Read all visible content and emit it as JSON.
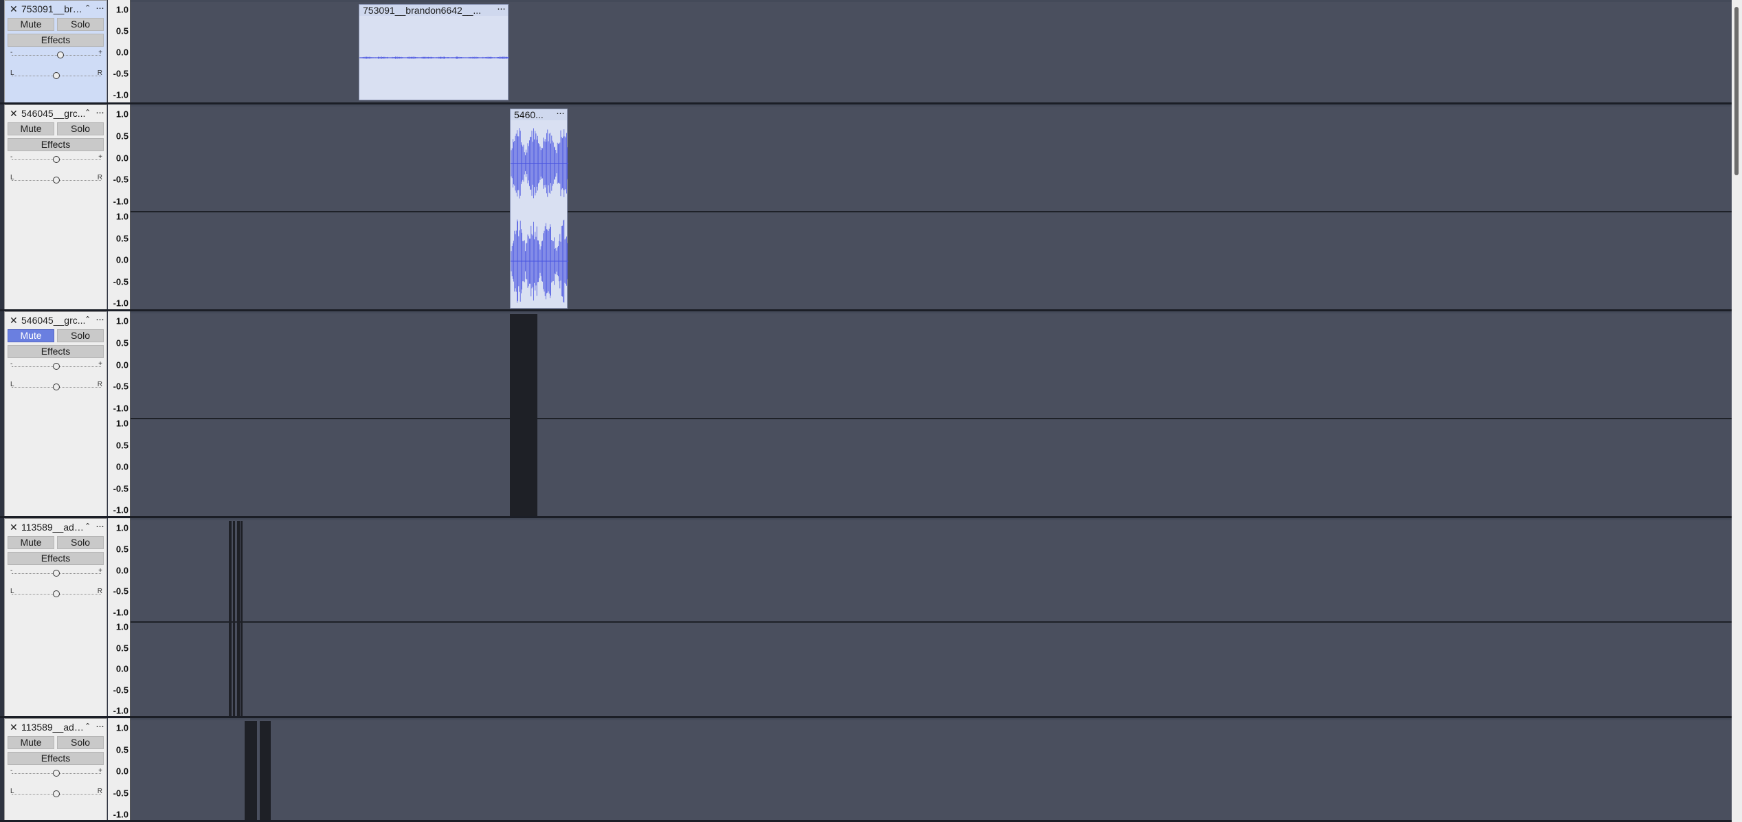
{
  "tracks": [
    {
      "id": "t1",
      "name": "753091__bra...",
      "selected": true,
      "mute": {
        "label": "Mute",
        "active": false
      },
      "solo": {
        "label": "Solo"
      },
      "effects_label": "Effects",
      "gain_minus": "-",
      "gain_plus": "+",
      "pan_left": "L",
      "pan_right": "R",
      "gain_level": 0.55,
      "pan_level": 0.5,
      "channels": 1,
      "clips": [
        {
          "title": "753091__brandon6642__...",
          "amplitude": 0.03
        }
      ]
    },
    {
      "id": "t2",
      "name": "546045__grc...",
      "selected": false,
      "mute": {
        "label": "Mute",
        "active": false
      },
      "solo": {
        "label": "Solo"
      },
      "effects_label": "Effects",
      "gain_minus": "-",
      "gain_plus": "+",
      "pan_left": "L",
      "pan_right": "R",
      "gain_level": 0.5,
      "pan_level": 0.5,
      "channels": 2,
      "clips": [
        {
          "title": "5460...",
          "amplitude": 0.95
        }
      ]
    },
    {
      "id": "t3",
      "name": "546045__grc...",
      "selected": false,
      "mute": {
        "label": "Mute",
        "active": true
      },
      "solo": {
        "label": "Solo"
      },
      "effects_label": "Effects",
      "gain_minus": "-",
      "gain_plus": "+",
      "pan_left": "L",
      "pan_right": "R",
      "gain_level": 0.5,
      "pan_level": 0.5,
      "channels": 2,
      "clips": []
    },
    {
      "id": "t4",
      "name": "113589__ada...",
      "selected": false,
      "mute": {
        "label": "Mute",
        "active": false
      },
      "solo": {
        "label": "Solo"
      },
      "effects_label": "Effects",
      "gain_minus": "-",
      "gain_plus": "+",
      "pan_left": "L",
      "pan_right": "R",
      "gain_level": 0.5,
      "pan_level": 0.5,
      "channels": 2,
      "clips": []
    },
    {
      "id": "t5",
      "name": "113589__ada...",
      "selected": false,
      "mute": {
        "label": "Mute",
        "active": false
      },
      "solo": {
        "label": "Solo"
      },
      "effects_label": "Effects",
      "gain_minus": "-",
      "gain_plus": "+",
      "pan_left": "L",
      "pan_right": "R",
      "gain_level": 0.5,
      "pan_level": 0.5,
      "channels": 1,
      "clips": []
    }
  ],
  "scale_labels": [
    "1.0",
    "0.5",
    "0.0",
    "-0.5",
    "-1.0"
  ],
  "icons": {
    "close": "close-icon",
    "collapse": "collapse-icon",
    "menu": "menu-icon"
  },
  "colors": {
    "waveform": "#4a55e0",
    "mute_active": "#6a7fe0",
    "selected_panel": "#cfdcf6"
  }
}
